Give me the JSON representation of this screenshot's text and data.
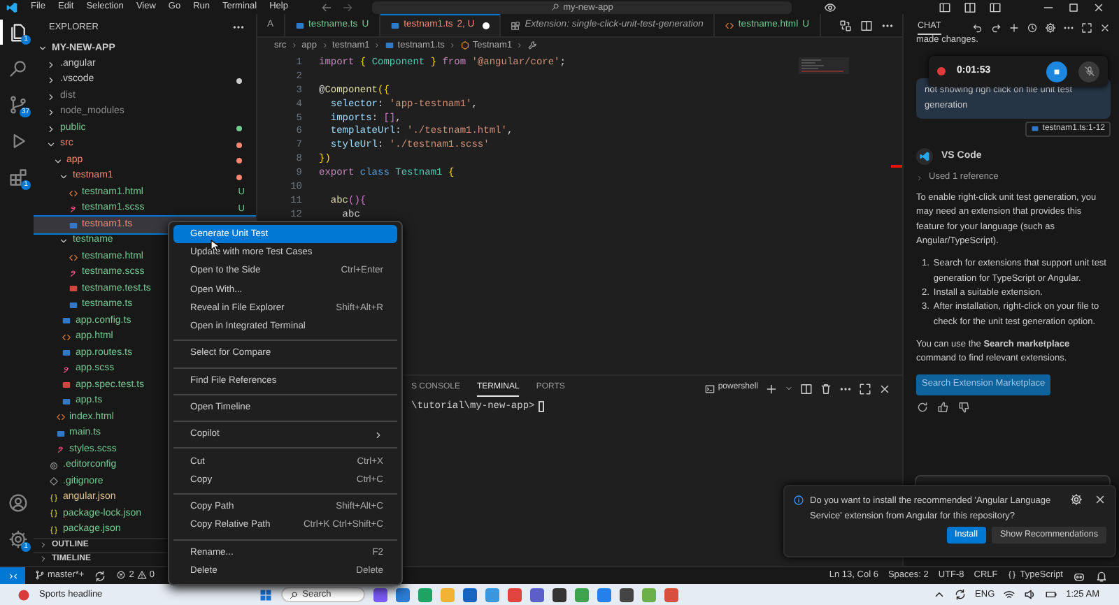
{
  "title_bar": {
    "menus": [
      "File",
      "Edit",
      "Selection",
      "View",
      "Go",
      "Run",
      "Terminal",
      "Help"
    ],
    "search": "my-new-app"
  },
  "activity_bar": {
    "items": [
      {
        "kind": "explorer",
        "selected": true,
        "badge": "1"
      },
      {
        "kind": "search",
        "selected": false
      },
      {
        "kind": "source-control",
        "selected": false,
        "badge": "37"
      },
      {
        "kind": "run",
        "selected": false
      },
      {
        "kind": "extensions",
        "selected": false,
        "badge": "1"
      }
    ],
    "bottom": [
      {
        "kind": "account"
      },
      {
        "kind": "settings",
        "badge": "1"
      }
    ]
  },
  "explorer": {
    "title": "EXPLORER",
    "root": {
      "label": "MY-NEW-APP",
      "expanded": true
    },
    "tree": [
      {
        "label": ".angular",
        "kind": "folder",
        "color": "#cccccc",
        "expanded": false,
        "selected": false
      },
      {
        "label": ".vscode",
        "kind": "folder",
        "color": "#cccccc",
        "dot": true,
        "expanded": false,
        "selected": false
      },
      {
        "label": "dist",
        "kind": "folder",
        "color": "#8c8c8c",
        "expanded": false,
        "selected": false
      },
      {
        "label": "node_modules",
        "kind": "folder",
        "color": "#8c8c8c",
        "expanded": false,
        "selected": false
      },
      {
        "label": "public",
        "kind": "folder",
        "color": "#73c991",
        "dot": true,
        "expanded": false,
        "selected": false
      },
      {
        "label": "src",
        "kind": "folder",
        "color": "#f48771",
        "dot": true,
        "expanded": true,
        "selected": false,
        "children": [
          {
            "label": "app",
            "kind": "folder",
            "color": "#f48771",
            "dot": true,
            "expanded": true,
            "selected": false,
            "children": [
              {
                "label": "testnam1",
                "kind": "folder",
                "color": "#f48771",
                "dot": true,
                "expanded": true,
                "selected": false,
                "children": [
                  {
                    "label": "testnam1.html",
                    "kind": "html",
                    "color": "#73c991",
                    "badge": "U",
                    "selected": false
                  },
                  {
                    "label": "testnam1.scss",
                    "kind": "scss",
                    "color": "#73c991",
                    "badge": "U",
                    "selected": false
                  },
                  {
                    "label": "testnam1.ts",
                    "kind": "ts",
                    "color": "#f48771",
                    "selected": true
                  }
                ]
              },
              {
                "label": "testname",
                "kind": "folder",
                "color": "#73c991",
                "expanded": true,
                "selected": false,
                "children": [
                  {
                    "label": "testname.html",
                    "kind": "html",
                    "color": "#73c991",
                    "selected": false
                  },
                  {
                    "label": "testname.scss",
                    "kind": "scss",
                    "color": "#73c991",
                    "selected": false
                  },
                  {
                    "label": "testname.test.ts",
                    "kind": "test",
                    "color": "#73c991",
                    "selected": false
                  },
                  {
                    "label": "testname.ts",
                    "kind": "ts",
                    "color": "#73c991",
                    "selected": false
                  }
                ]
              },
              {
                "label": "app.config.ts",
                "kind": "ts",
                "color": "#73c991",
                "selected": false
              },
              {
                "label": "app.html",
                "kind": "html",
                "color": "#73c991",
                "selected": false
              },
              {
                "label": "app.routes.ts",
                "kind": "ts",
                "color": "#73c991",
                "selected": false
              },
              {
                "label": "app.scss",
                "kind": "scss",
                "color": "#73c991",
                "selected": false
              },
              {
                "label": "app.spec.test.ts",
                "kind": "test",
                "color": "#73c991",
                "selected": false
              },
              {
                "label": "app.ts",
                "kind": "ts",
                "color": "#73c991",
                "selected": false
              }
            ]
          },
          {
            "label": "index.html",
            "kind": "html",
            "color": "#73c991",
            "selected": false
          },
          {
            "label": "main.ts",
            "kind": "ts",
            "color": "#73c991",
            "selected": false
          },
          {
            "label": "styles.scss",
            "kind": "scss",
            "color": "#73c991",
            "selected": false
          }
        ]
      },
      {
        "label": ".editorconfig",
        "kind": "config",
        "color": "#73c991",
        "selected": false
      },
      {
        "label": ".gitignore",
        "kind": "git",
        "color": "#73c991",
        "selected": false
      },
      {
        "label": "angular.json",
        "kind": "json",
        "color": "#e2c08d",
        "selected": false
      },
      {
        "label": "package-lock.json",
        "kind": "json",
        "color": "#73c991",
        "selected": false
      },
      {
        "label": "package.json",
        "kind": "json",
        "color": "#73c991",
        "selected": false
      }
    ],
    "sections": [
      {
        "label": "OUTLINE",
        "expanded": false
      },
      {
        "label": "TIMELINE",
        "expanded": false
      }
    ]
  },
  "editor": {
    "tabs": [
      {
        "label": "A",
        "kind": "plain",
        "color": "#9d9d9d",
        "selected": false
      },
      {
        "label": "testname.ts",
        "kind": "ts",
        "color": "#73c991",
        "badge": "U",
        "selected": false
      },
      {
        "label": "testnam1.ts",
        "kind": "ts",
        "color": "#f48771",
        "badge": "2, U",
        "dirty": true,
        "selected": true
      },
      {
        "label": "Extension: single-click-unit-test-generation",
        "kind": "extension",
        "color": "#9d9d9d",
        "preview": true,
        "selected": false
      },
      {
        "label": "testname.html",
        "kind": "html",
        "color": "#73c991",
        "badge": "U",
        "selected": false
      }
    ],
    "breadcrumb": [
      {
        "label": "src",
        "kind": "folder"
      },
      {
        "label": "app",
        "kind": "folder"
      },
      {
        "label": "testnam1",
        "kind": "folder"
      },
      {
        "label": "testnam1.ts",
        "kind": "ts"
      },
      {
        "label": "Testnam1",
        "kind": "class"
      },
      {
        "kind": "method"
      }
    ],
    "code_lines": [
      {
        "number": "1",
        "tokens": [
          {
            "kind": "keyword",
            "text": "import "
          },
          {
            "kind": "bracket",
            "text": "{ "
          },
          {
            "kind": "type",
            "text": "Component "
          },
          {
            "kind": "bracket",
            "text": "} "
          },
          {
            "kind": "keyword",
            "text": "from "
          },
          {
            "kind": "string",
            "text": "'@angular/core'"
          },
          {
            "kind": "plain",
            "text": ";"
          }
        ]
      },
      {
        "number": "2"
      },
      {
        "number": "3",
        "tokens": [
          {
            "kind": "plain",
            "text": "@"
          },
          {
            "kind": "function",
            "text": "Component"
          },
          {
            "kind": "bracket",
            "text": "({"
          }
        ]
      },
      {
        "number": "4",
        "tokens": [
          {
            "kind": "property",
            "text": "  selector"
          },
          {
            "kind": "plain",
            "text": ": "
          },
          {
            "kind": "string",
            "text": "'app-testnam1'"
          },
          {
            "kind": "plain",
            "text": ","
          }
        ]
      },
      {
        "number": "5",
        "tokens": [
          {
            "kind": "property",
            "text": "  imports"
          },
          {
            "kind": "plain",
            "text": ": "
          },
          {
            "kind": "bracket2",
            "text": "[]"
          },
          {
            "kind": "plain",
            "text": ","
          }
        ]
      },
      {
        "number": "6",
        "tokens": [
          {
            "kind": "property",
            "text": "  templateUrl"
          },
          {
            "kind": "plain",
            "text": ": "
          },
          {
            "kind": "string",
            "text": "'./testnam1.html'"
          },
          {
            "kind": "plain",
            "text": ","
          }
        ]
      },
      {
        "number": "7",
        "tokens": [
          {
            "kind": "property",
            "text": "  styleUrl"
          },
          {
            "kind": "plain",
            "text": ": "
          },
          {
            "kind": "string",
            "text": "'./testnam1.scss'"
          }
        ]
      },
      {
        "number": "8",
        "tokens": [
          {
            "kind": "bracket",
            "text": "})"
          }
        ]
      },
      {
        "number": "9",
        "tokens": [
          {
            "kind": "keyword",
            "text": "export "
          },
          {
            "kind": "storage",
            "text": "class "
          },
          {
            "kind": "type",
            "text": "Testnam1 "
          },
          {
            "kind": "bracket",
            "text": "{"
          }
        ]
      },
      {
        "number": "10"
      },
      {
        "number": "11",
        "tokens": [
          {
            "kind": "function",
            "text": "  abc"
          },
          {
            "kind": "bracket2",
            "text": "(){"
          }
        ]
      },
      {
        "number": "12",
        "tokens": [
          {
            "kind": "plain",
            "text": "    abc"
          }
        ]
      }
    ]
  },
  "panel": {
    "tabs": [
      {
        "label": "S CONSOLE",
        "selected": false
      },
      {
        "label": "TERMINAL",
        "selected": true
      },
      {
        "label": "PORTS",
        "selected": false
      }
    ],
    "shell": "powershell",
    "prompt": "\\tutorial\\my-new-app>"
  },
  "chat": {
    "title": "CHAT",
    "text": "made changes.",
    "recording": {
      "time": "0:01:53"
    },
    "request": {
      "text": "not showing righ click on file unit test generation",
      "reference": "testnam1.ts:1-12"
    },
    "response": {
      "author": "VS Code",
      "references": "Used 1 reference",
      "intro": "To enable right-click unit test generation, you may need an extension that provides this feature for your language (such as Angular/TypeScript).",
      "steps": [
        {
          "number": "1.",
          "text": "Search for extensions that support unit test generation for TypeScript or Angular."
        },
        {
          "number": "2.",
          "text": "Install a suitable extension."
        },
        {
          "number": "3.",
          "text": "After installation, right-click on your file to check for the unit test generation option."
        }
      ],
      "outro": "You can use the **Search marketplace** command to find relevant extensions.",
      "button": "Search Extension Marketplace"
    }
  },
  "context_menu": {
    "groups": [
      [
        {
          "label": "Generate Unit Test",
          "selected": true
        },
        {
          "label": "Update with more Test Cases",
          "selected": false
        },
        {
          "label": "Open to the Side",
          "shortcut": "Ctrl+Enter",
          "selected": false
        },
        {
          "label": "Open With...",
          "selected": false
        },
        {
          "label": "Reveal in File Explorer",
          "shortcut": "Shift+Alt+R",
          "selected": false
        },
        {
          "label": "Open in Integrated Terminal",
          "selected": false
        }
      ],
      [
        {
          "label": "Select for Compare",
          "selected": false
        }
      ],
      [
        {
          "label": "Find File References",
          "selected": false
        }
      ],
      [
        {
          "label": "Open Timeline",
          "selected": false
        }
      ],
      [
        {
          "label": "Copilot",
          "submenu": true,
          "selected": false
        }
      ],
      [
        {
          "label": "Cut",
          "shortcut": "Ctrl+X",
          "selected": false
        },
        {
          "label": "Copy",
          "shortcut": "Ctrl+C",
          "selected": false
        }
      ],
      [
        {
          "label": "Copy Path",
          "shortcut": "Shift+Alt+C",
          "selected": false
        },
        {
          "label": "Copy Relative Path",
          "shortcut": "Ctrl+K Ctrl+Shift+C",
          "selected": false
        }
      ],
      [
        {
          "label": "Rename...",
          "shortcut": "F2",
          "selected": false
        },
        {
          "label": "Delete",
          "shortcut": "Delete",
          "selected": false
        }
      ]
    ]
  },
  "notification": {
    "message": "Do you want to install the recommended 'Angular Language Service' extension from Angular for this repository?",
    "buttons": [
      {
        "label": "Install",
        "kind": "primary"
      },
      {
        "label": "Show Recommendations",
        "kind": "secondary"
      }
    ]
  },
  "status_bar": {
    "branch": "master*+",
    "errors": "2",
    "warnings": "0",
    "right": [
      {
        "kind": "text",
        "text": "Ln 13, Col 6"
      },
      {
        "kind": "text",
        "text": "Spaces: 2"
      },
      {
        "kind": "text",
        "text": "UTF-8"
      },
      {
        "kind": "text",
        "text": "CRLF"
      },
      {
        "kind": "language",
        "text": "TypeScript"
      }
    ]
  },
  "taskbar": {
    "widget": "Sports headline",
    "search": "Search",
    "language": "ENG",
    "time": "1:25 AM"
  }
}
